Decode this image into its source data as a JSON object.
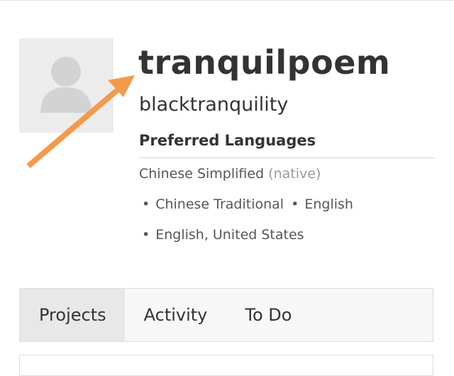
{
  "profile": {
    "username": "tranquilpoem",
    "display_name": "blacktranquility",
    "avatar_icon": "user-silhouette-icon"
  },
  "languages": {
    "heading": "Preferred Languages",
    "native_language": "Chinese Simplified",
    "native_tag": "(native)",
    "line_2": [
      "Chinese Traditional",
      "English"
    ],
    "line_3": [
      "English, United States"
    ],
    "bullet": "•"
  },
  "tabs": [
    {
      "label": "Projects",
      "active": true
    },
    {
      "label": "Activity",
      "active": false
    },
    {
      "label": "To Do",
      "active": false
    }
  ],
  "annotation": {
    "arrow_icon": "orange-arrow-icon",
    "color": "#f39a4c"
  }
}
